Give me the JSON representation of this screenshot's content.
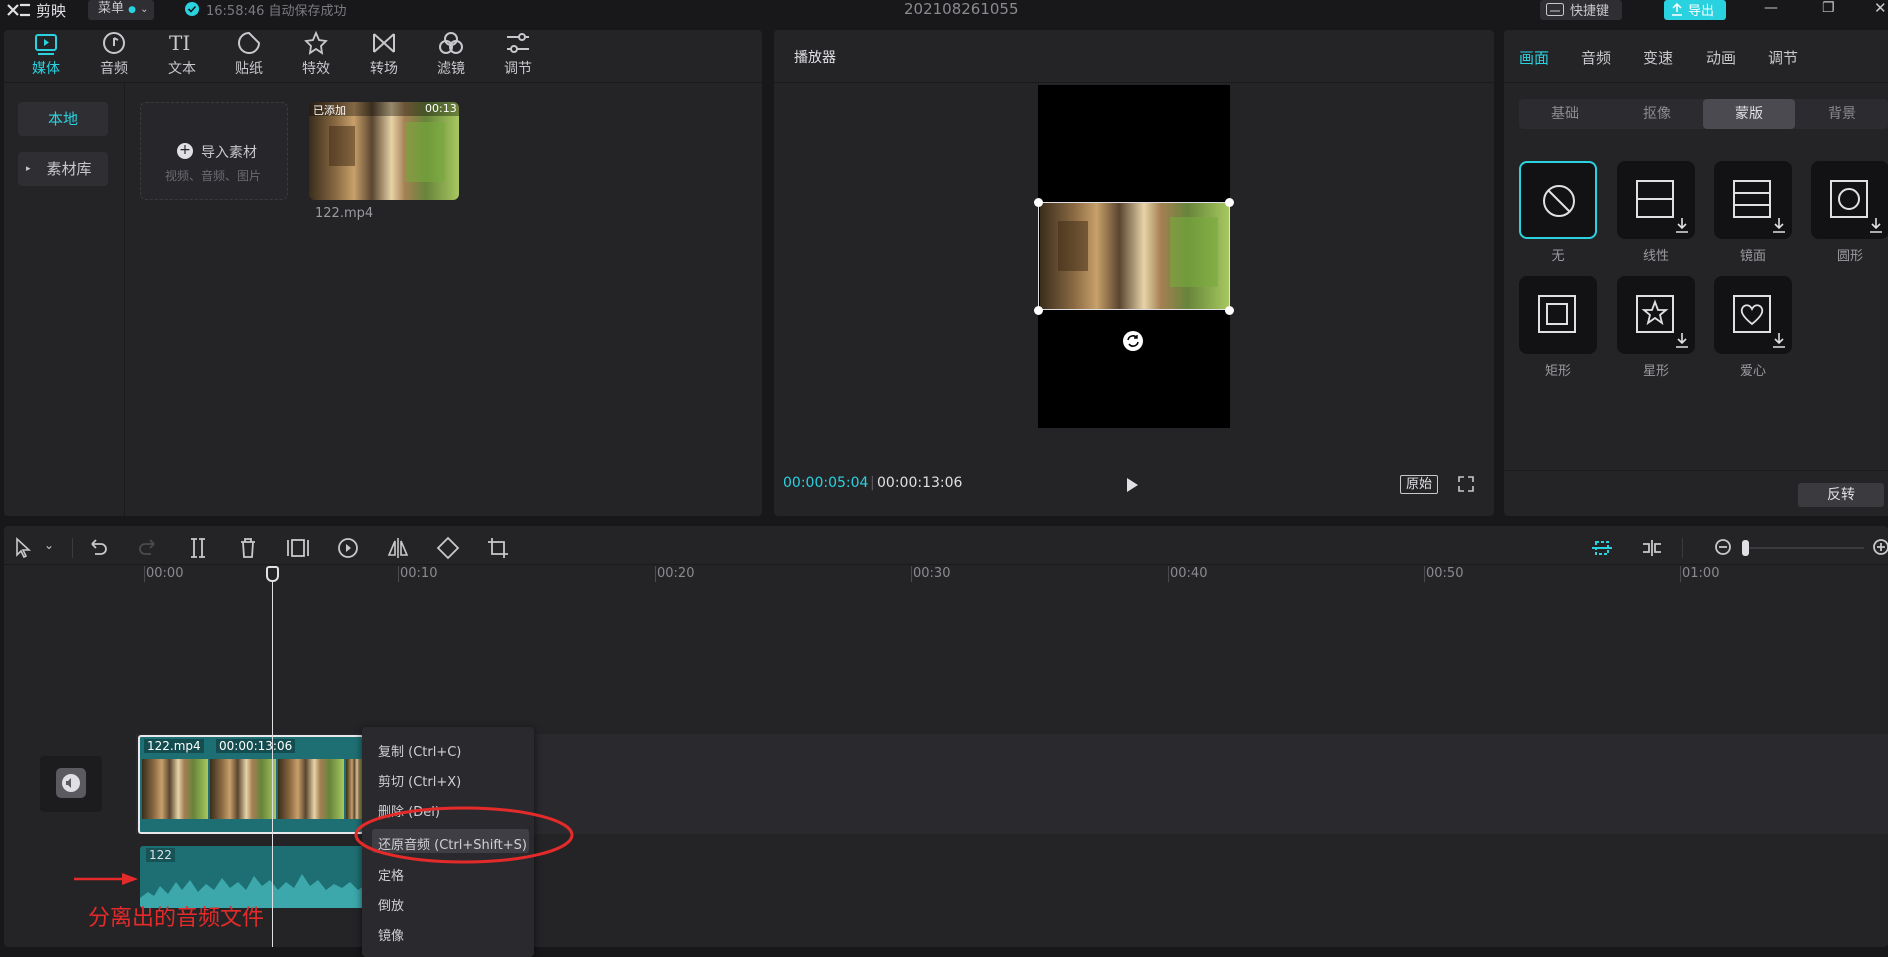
{
  "titlebar": {
    "app_name": "剪映",
    "menu_label": "菜单",
    "autosave_text": "16:58:46 自动保存成功",
    "project_name": "202108261055",
    "shortcut_label": "快捷键",
    "export_label": "导出"
  },
  "toolbar": {
    "items": [
      {
        "label": "媒体",
        "icon": "media-icon"
      },
      {
        "label": "音频",
        "icon": "audio-icon"
      },
      {
        "label": "文本",
        "icon": "text-icon"
      },
      {
        "label": "贴纸",
        "icon": "sticker-icon"
      },
      {
        "label": "特效",
        "icon": "effects-icon"
      },
      {
        "label": "转场",
        "icon": "transition-icon"
      },
      {
        "label": "滤镜",
        "icon": "filter-icon"
      },
      {
        "label": "调节",
        "icon": "adjust-icon"
      }
    ]
  },
  "media": {
    "side_local": "本地",
    "side_library": "素材库",
    "import_label": "导入素材",
    "import_hint": "视频、音频、图片",
    "clip_badge": "已添加",
    "clip_duration": "00:13",
    "clip_name": "122.mp4"
  },
  "player": {
    "title": "播放器",
    "current_time": "00:00:05:04",
    "total_time": "00:00:13:06",
    "original_label": "原始"
  },
  "inspector": {
    "tabs": [
      "画面",
      "音频",
      "变速",
      "动画",
      "调节"
    ],
    "segments": [
      "基础",
      "抠像",
      "蒙版",
      "背景"
    ],
    "masks": [
      {
        "label": "无",
        "icon": "none-icon"
      },
      {
        "label": "线性",
        "icon": "linear-mask-icon"
      },
      {
        "label": "镜面",
        "icon": "mirror-mask-icon"
      },
      {
        "label": "圆形",
        "icon": "circle-mask-icon"
      },
      {
        "label": "矩形",
        "icon": "rect-mask-icon"
      },
      {
        "label": "星形",
        "icon": "star-mask-icon"
      },
      {
        "label": "爱心",
        "icon": "heart-mask-icon"
      }
    ],
    "invert_label": "反转"
  },
  "timeline": {
    "ruler": [
      "00:00",
      "00:10",
      "00:20",
      "00:30",
      "00:40",
      "00:50",
      "01:00"
    ],
    "video_clip_name": "122.mp4",
    "video_clip_duration": "00:00:13:06",
    "audio_clip_name": "122",
    "annotation": "分离出的音频文件"
  },
  "context_menu": {
    "items": [
      "复制 (Ctrl+C)",
      "剪切 (Ctrl+X)",
      "删除 (Del)",
      "还原音频 (Ctrl+Shift+S)",
      "定格",
      "倒放",
      "镜像"
    ]
  },
  "colors": {
    "accent": "#2ad2e0",
    "annotation_red": "#e52a2a",
    "clip_teal": "#1e6f73"
  }
}
